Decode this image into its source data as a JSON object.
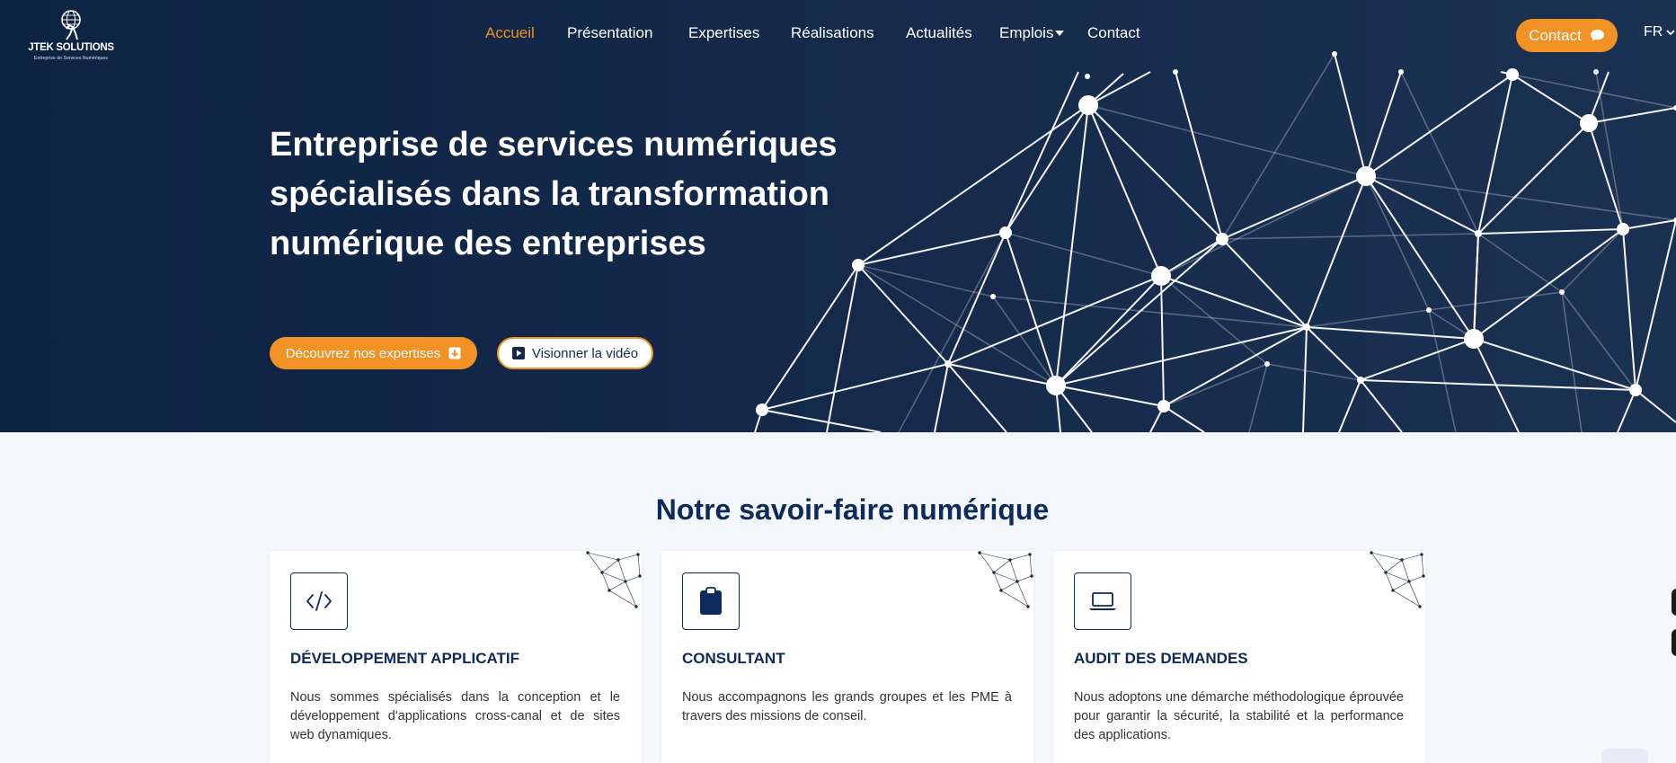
{
  "header": {
    "logo_name": "JTEK SOLUTIONS",
    "logo_tagline": "Entreprise de Services Numériques",
    "nav": [
      {
        "label": "Accueil",
        "active": true
      },
      {
        "label": "Présentation"
      },
      {
        "label": "Expertises"
      },
      {
        "label": "Réalisations"
      },
      {
        "label": "Actualités"
      },
      {
        "label": "Emplois",
        "dropdown": true
      },
      {
        "label": "Contact"
      }
    ],
    "contact_button": "Contact",
    "language": "FR"
  },
  "hero": {
    "title_lines": [
      "Entreprise de services numériques",
      "spécialisés dans la transformation",
      "numérique des entreprises"
    ],
    "primary_button": "Découvrez nos expertises",
    "secondary_button": "Visionner la vidéo"
  },
  "section": {
    "title": "Notre savoir-faire numérique",
    "cards": [
      {
        "icon": "code-icon",
        "title": "DÉVELOPPEMENT APPLICATIF",
        "text": "Nous sommes spécialisés dans la conception et le développement d'applications cross-canal et de sites web dynamiques."
      },
      {
        "icon": "clipboard-icon",
        "title": "CONSULTANT",
        "text": "Nous accompagnons les grands groupes et les PME à travers des missions de conseil."
      },
      {
        "icon": "laptop-icon",
        "title": "AUDIT DES DEMANDES",
        "text": "Nous adoptons une démarche méthodologique éprouvée pour garantir la sécurité, la stabilité et la performance des applications."
      }
    ]
  },
  "colors": {
    "hero_bg": "#14294a",
    "accent": "#f39224",
    "heading": "#0d2a5c",
    "section_bg": "#f4f8fc"
  }
}
